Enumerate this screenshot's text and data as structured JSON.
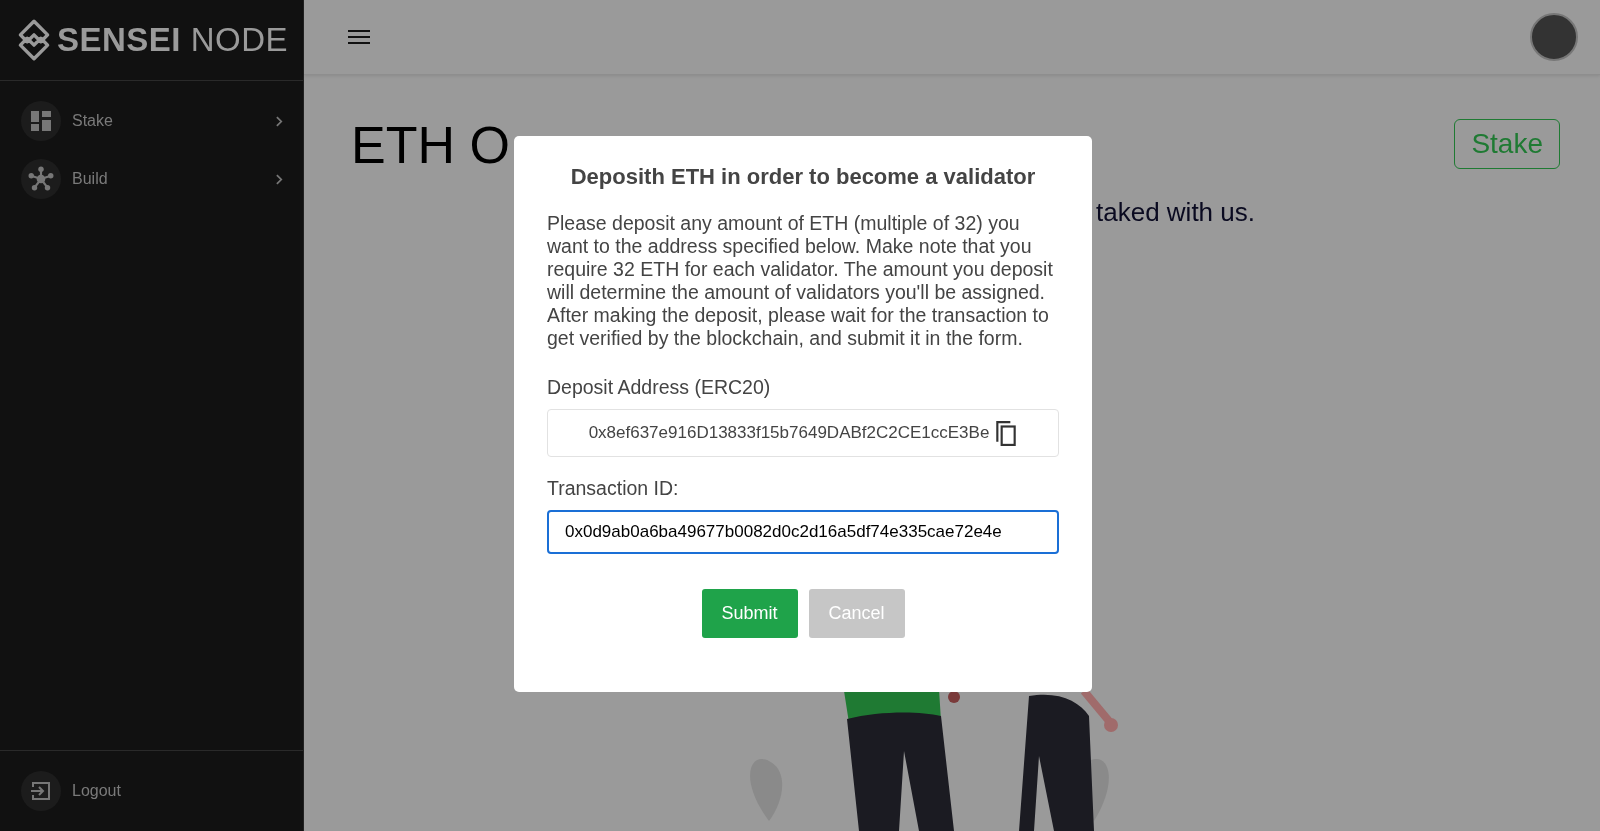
{
  "sidebar": {
    "brand_bold": "SENSEI",
    "brand_light": "NODE",
    "items": [
      {
        "label": "Stake",
        "kind": "grid"
      },
      {
        "label": "Build",
        "kind": "network"
      }
    ],
    "footer_item": {
      "label": "Logout"
    }
  },
  "page": {
    "title": "ETH O",
    "subtitle": "taked with us.",
    "stake_button": "Stake"
  },
  "modal": {
    "title": "Deposith ETH in order to become a validator",
    "body": "Please deposit any amount of ETH (multiple of 32) you want to the address specified below. Make note that you require 32 ETH for each validator. The amount you deposit will determine the amount of validators you'll be assigned. After making the deposit, please wait for the transaction to get verified by the blockchain, and submit it in the form.",
    "address_label": "Deposit Address (ERC20)",
    "address": "0x8ef637e916D13833f15b7649DABf2C2CE1ccE3Be",
    "txid_label": "Transaction ID:",
    "txid_value": "0x0d9ab0a6ba49677b0082d0c2d16a5df74e335cae72e4e",
    "buttons": [
      {
        "label": "Submit",
        "kind": "primary"
      },
      {
        "label": "Cancel",
        "kind": "secondary"
      }
    ]
  }
}
